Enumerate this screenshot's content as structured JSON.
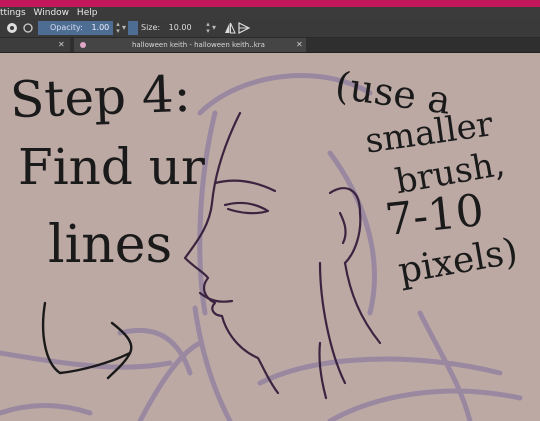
{
  "menu": {
    "items": [
      "ttings",
      "Window",
      "Help"
    ]
  },
  "toolbar": {
    "opacity_label": "Opacity:",
    "opacity_value": "1.00",
    "size_label": "Size:",
    "size_value": "10.00 px",
    "icons": [
      "brush-preset-icon",
      "reset-icon",
      "mirror-horizontal-icon",
      "mirror-vertical-icon"
    ]
  },
  "tabs": [
    {
      "label": "halloween keith - halloween keith..kra"
    }
  ],
  "canvas": {
    "text_left": [
      "Step 4:",
      "Find ur",
      "lines"
    ],
    "text_right": [
      "(use a",
      "smaller",
      "brush,",
      "7-10",
      "pixels)"
    ],
    "background_color": "#bca9a4",
    "sketch_color": "#8f7ea0"
  },
  "colors": {
    "title_bar": "#c2185b",
    "toolbar": "#3a3a3a",
    "accent_field": "#4e6d93"
  }
}
